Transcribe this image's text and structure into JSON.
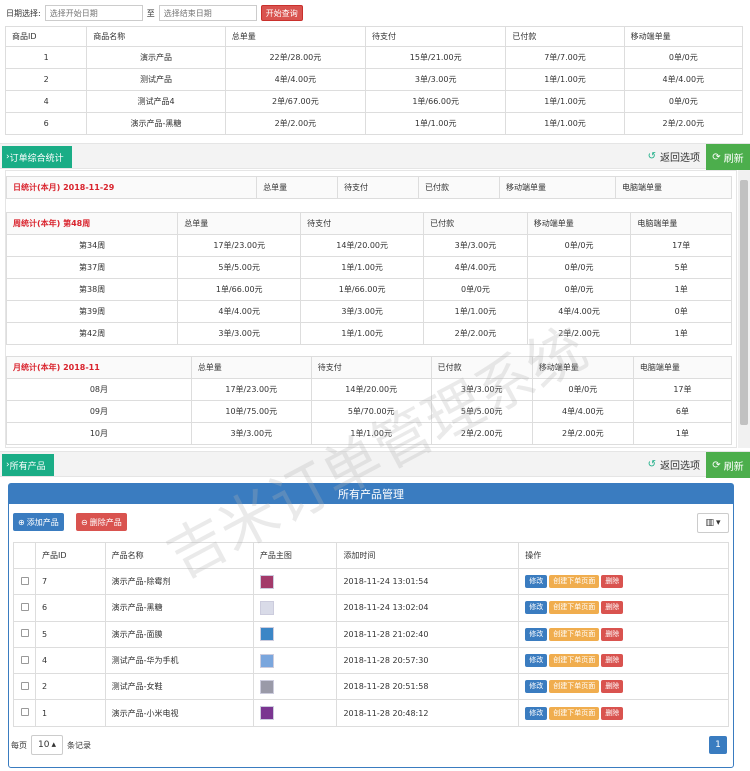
{
  "filter": {
    "label": "日期选择:",
    "start_placeholder": "选择开始日期",
    "separator": "至",
    "end_placeholder": "选择结束日期",
    "query_button": "开始查询"
  },
  "top_table": {
    "headers": [
      "商品ID",
      "商品名称",
      "总单量",
      "待支付",
      "已付款",
      "移动端单量"
    ],
    "rows": [
      [
        "1",
        "演示产品",
        "22单/28.00元",
        "15单/21.00元",
        "7单/7.00元",
        "0单/0元"
      ],
      [
        "2",
        "测试产品",
        "4单/4.00元",
        "3单/3.00元",
        "1单/1.00元",
        "4单/4.00元"
      ],
      [
        "4",
        "测试产品4",
        "2单/67.00元",
        "1单/66.00元",
        "1单/1.00元",
        "0单/0元"
      ],
      [
        "6",
        "演示产品-黑糖",
        "2单/2.00元",
        "1单/1.00元",
        "1单/1.00元",
        "2单/2.00元"
      ]
    ]
  },
  "order_section": {
    "tab": "订单综合统计",
    "return_label": "返回选项",
    "refresh_label": "刷新"
  },
  "daily": {
    "headers": [
      "日统计(本月) 2018-11-29",
      "总单量",
      "待支付",
      "已付款",
      "移动端单量",
      "电脑端单量"
    ]
  },
  "weekly": {
    "headers": [
      "周统计(本年) 第48周",
      "总单量",
      "待支付",
      "已付款",
      "移动端单量",
      "电脑端单量"
    ],
    "rows": [
      [
        "第34周",
        "17单/23.00元",
        "14单/20.00元",
        "3单/3.00元",
        "0单/0元",
        "17单"
      ],
      [
        "第37周",
        "5单/5.00元",
        "1单/1.00元",
        "4单/4.00元",
        "0单/0元",
        "5单"
      ],
      [
        "第38周",
        "1单/66.00元",
        "1单/66.00元",
        "0单/0元",
        "0单/0元",
        "1单"
      ],
      [
        "第39周",
        "4单/4.00元",
        "3单/3.00元",
        "1单/1.00元",
        "4单/4.00元",
        "0单"
      ],
      [
        "第42周",
        "3单/3.00元",
        "1单/1.00元",
        "2单/2.00元",
        "2单/2.00元",
        "1单"
      ]
    ]
  },
  "monthly": {
    "headers": [
      "月统计(本年) 2018-11",
      "总单量",
      "待支付",
      "已付款",
      "移动端单量",
      "电脑端单量"
    ],
    "rows": [
      [
        "08月",
        "17单/23.00元",
        "14单/20.00元",
        "3单/3.00元",
        "0单/0元",
        "17单"
      ],
      [
        "09月",
        "10单/75.00元",
        "5单/70.00元",
        "5单/5.00元",
        "4单/4.00元",
        "6单"
      ],
      [
        "10月",
        "3单/3.00元",
        "1单/1.00元",
        "2单/2.00元",
        "2单/2.00元",
        "1单"
      ]
    ]
  },
  "product_section": {
    "tab": "所有产品",
    "return_label": "返回选项",
    "refresh_label": "刷新"
  },
  "products": {
    "title": "所有产品管理",
    "add_button": "添加产品",
    "delete_button": "删除产品",
    "headers": [
      "产品ID",
      "产品名称",
      "产品主图",
      "添加时间",
      "操作"
    ],
    "rows": [
      {
        "id": "7",
        "name": "演示产品-除霉剂",
        "time": "2018-11-24 13:01:54",
        "thumb": "#a33a6a"
      },
      {
        "id": "6",
        "name": "演示产品-黑糖",
        "time": "2018-11-24 13:02:04",
        "thumb": "#d9dbe8"
      },
      {
        "id": "5",
        "name": "演示产品-面膜",
        "time": "2018-11-28 21:02:40",
        "thumb": "#3b86c6"
      },
      {
        "id": "4",
        "name": "测试产品-华为手机",
        "time": "2018-11-28 20:57:30",
        "thumb": "#7aa6dd"
      },
      {
        "id": "2",
        "name": "测试产品-女鞋",
        "time": "2018-11-28 20:51:58",
        "thumb": "#9a9aa8"
      },
      {
        "id": "1",
        "name": "演示产品-小米电视",
        "time": "2018-11-28 20:48:12",
        "thumb": "#7a3590"
      }
    ],
    "op_edit": "修改",
    "op_page": "创建下单页面",
    "op_delete": "删除",
    "per_page_label": "每页",
    "per_page_value": "10",
    "records_label": "条记录",
    "current_page": "1"
  },
  "watermark": "吉米订单管理系统"
}
